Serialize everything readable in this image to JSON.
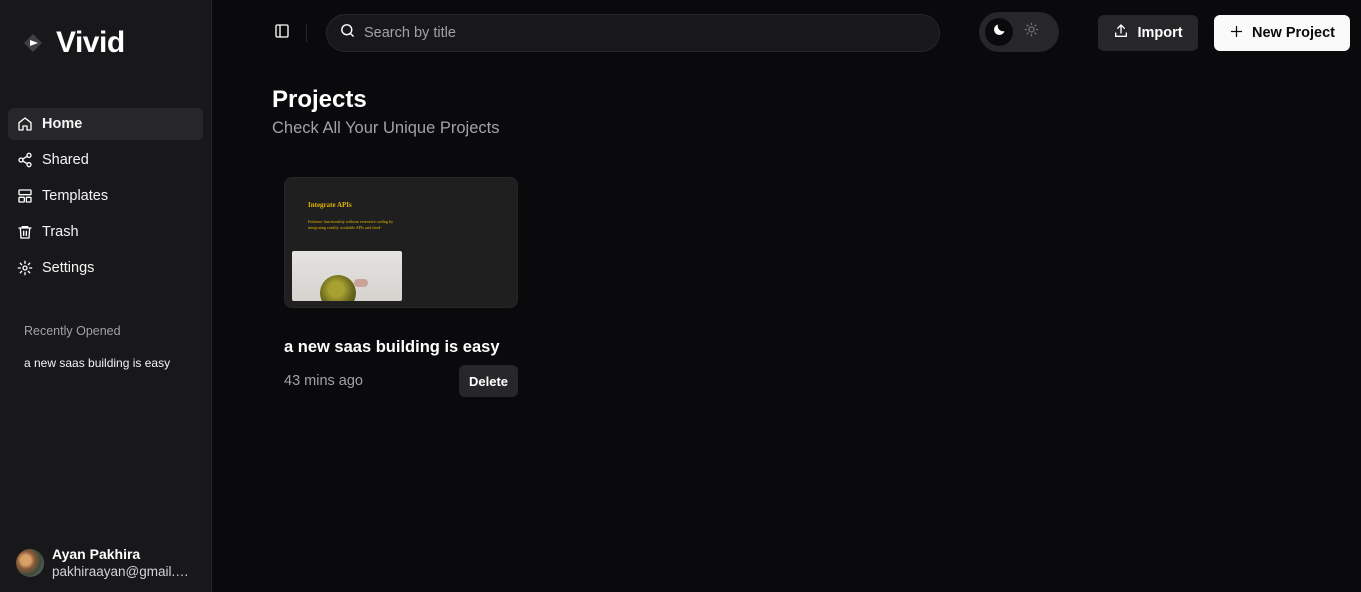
{
  "brand": {
    "name": "Vivid",
    "logo_icon": "vivid-logo-icon"
  },
  "sidebar": {
    "items": [
      {
        "label": "Home",
        "icon": "home-icon",
        "active": true
      },
      {
        "label": "Shared",
        "icon": "share-icon",
        "active": false
      },
      {
        "label": "Templates",
        "icon": "layout-icon",
        "active": false
      },
      {
        "label": "Trash",
        "icon": "trash-icon",
        "active": false
      },
      {
        "label": "Settings",
        "icon": "gear-icon",
        "active": false
      }
    ],
    "recent_title": "Recently Opened",
    "recent_items": [
      "a new saas building is easy"
    ]
  },
  "user": {
    "name": "Ayan Pakhira",
    "email": "pakhiraayan@gmail.com"
  },
  "search": {
    "placeholder": "Search by title",
    "value": ""
  },
  "theme": {
    "selected": "dark"
  },
  "header": {
    "import_label": "Import",
    "new_project_label": "New Project"
  },
  "main": {
    "title": "Projects",
    "subtitle": "Check All Your Unique Projects",
    "projects": [
      {
        "title": "a new saas building is easy",
        "time": "43 mins ago",
        "delete_label": "Delete",
        "thumbnail": {
          "heading": "Integrate APIs",
          "text": "Enhance functionality without extensive coding by integrating readily available APIs and third-"
        }
      }
    ]
  },
  "colors": {
    "background": "#0a0a0c",
    "sidebar": "#18181b",
    "accent_thumb_text": "#e0b400"
  }
}
